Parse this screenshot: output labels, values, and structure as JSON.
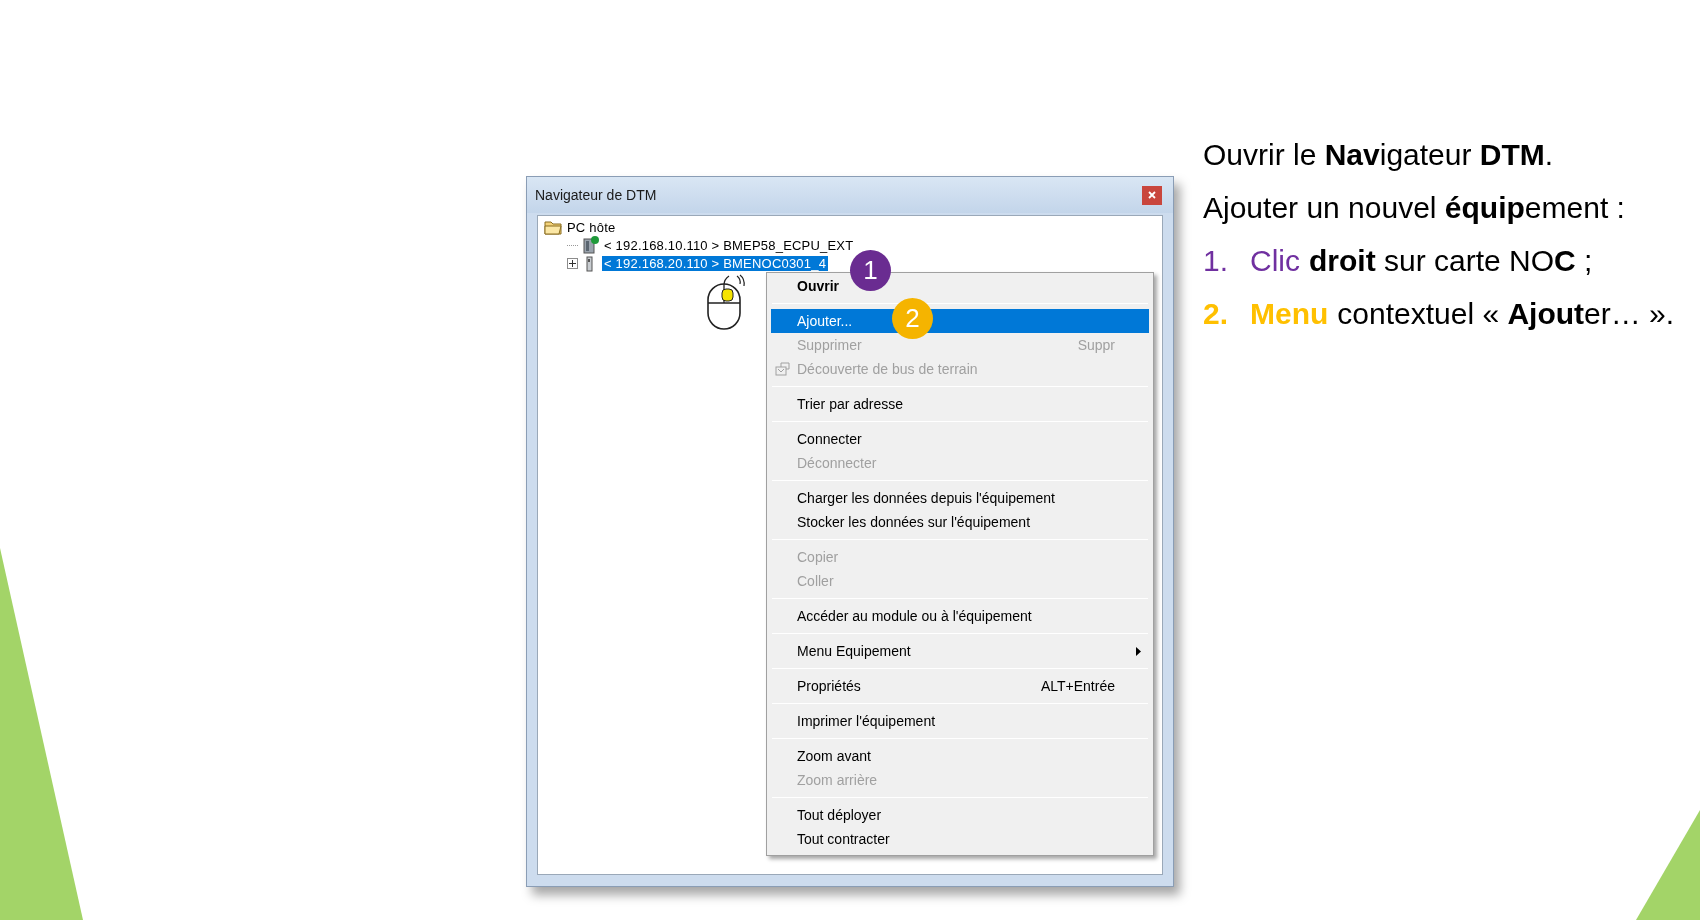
{
  "window": {
    "title": "Navigateur de DTM"
  },
  "tree": [
    {
      "kind": "folder",
      "label": "PC hôte",
      "selected": false,
      "children": [
        {
          "kind": "controller",
          "label": "< 192.168.10.110 > BMEP58_ECPU_EXT",
          "selected": false
        },
        {
          "kind": "module",
          "label": "< 192.168.20.110 > BMENOC0301_4",
          "selected": true,
          "expanded": false
        }
      ]
    }
  ],
  "context_menu": [
    {
      "kind": "item",
      "label": "Ouvrir",
      "bold": true,
      "disabled": false,
      "selected": false
    },
    {
      "kind": "separator"
    },
    {
      "kind": "item",
      "label": "Ajouter...",
      "disabled": false,
      "selected": true
    },
    {
      "kind": "item",
      "label": "Supprimer",
      "shortcut": "Suppr",
      "disabled": true,
      "selected": false
    },
    {
      "kind": "icon_item",
      "label": "Découverte de bus de terrain",
      "disabled": true,
      "selected": false
    },
    {
      "kind": "separator"
    },
    {
      "kind": "item",
      "label": "Trier par adresse",
      "disabled": false,
      "selected": false
    },
    {
      "kind": "separator"
    },
    {
      "kind": "item",
      "label": "Connecter",
      "disabled": false,
      "selected": false
    },
    {
      "kind": "item",
      "label": "Déconnecter",
      "disabled": true,
      "selected": false
    },
    {
      "kind": "separator"
    },
    {
      "kind": "item",
      "label": "Charger les données depuis l'équipement",
      "disabled": false,
      "selected": false
    },
    {
      "kind": "item",
      "label": "Stocker les données sur l'équipement",
      "disabled": false,
      "selected": false
    },
    {
      "kind": "separator"
    },
    {
      "kind": "item",
      "label": "Copier",
      "disabled": true,
      "selected": false
    },
    {
      "kind": "item",
      "label": "Coller",
      "disabled": true,
      "selected": false
    },
    {
      "kind": "separator"
    },
    {
      "kind": "item",
      "label": "Accéder au module ou à l'équipement",
      "disabled": false,
      "selected": false
    },
    {
      "kind": "separator"
    },
    {
      "kind": "item",
      "label": "Menu Equipement",
      "submenu": true,
      "disabled": false,
      "selected": false
    },
    {
      "kind": "separator"
    },
    {
      "kind": "item",
      "label": "Propriétés",
      "shortcut": "ALT+Entrée",
      "disabled": false,
      "selected": false
    },
    {
      "kind": "separator"
    },
    {
      "kind": "item",
      "label": "Imprimer l'équipement",
      "disabled": false,
      "selected": false
    },
    {
      "kind": "separator"
    },
    {
      "kind": "item",
      "label": "Zoom avant",
      "disabled": false,
      "selected": false
    },
    {
      "kind": "item",
      "label": "Zoom arrière",
      "disabled": true,
      "selected": false
    },
    {
      "kind": "separator"
    },
    {
      "kind": "item",
      "label": "Tout déployer",
      "disabled": false,
      "selected": false
    },
    {
      "kind": "item",
      "label": "Tout contracter",
      "disabled": false,
      "selected": false
    }
  ],
  "callouts": [
    {
      "label": "1",
      "color": "#6a2c91"
    },
    {
      "label": "2",
      "color": "#f5b400"
    }
  ],
  "instructions": {
    "lines": [
      "Ouvrir le **Nav**igateur **DTM**.",
      "Ajouter un nouvel **équip**ement :"
    ],
    "steps": [
      {
        "number": "1.",
        "keyword": "Clic",
        "text": "**droit** sur carte NO**C** ;",
        "color": "#7030a0",
        "bold": false
      },
      {
        "number": "2.",
        "keyword": "Menu",
        "text": "contextuel « **Ajout**er… ».",
        "color": "#ffc000",
        "bold": true
      }
    ]
  }
}
